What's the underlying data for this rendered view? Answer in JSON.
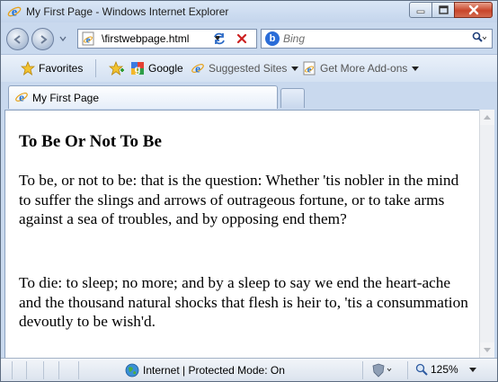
{
  "window": {
    "title": "My First Page - Windows Internet Explorer"
  },
  "address_bar": {
    "url": "\\firstwebpage.html"
  },
  "search": {
    "placeholder": "Bing"
  },
  "favorites_bar": {
    "favorites_label": "Favorites",
    "links": [
      {
        "label": "Google",
        "icon": "google-icon"
      },
      {
        "label": "Suggested Sites",
        "icon": "ie-page-icon"
      },
      {
        "label": "Get More Add-ons",
        "icon": "ie-page-icon"
      }
    ]
  },
  "tabs": [
    {
      "label": "My First Page",
      "active": true
    }
  ],
  "page": {
    "heading": "To Be Or Not To Be",
    "paragraphs": [
      "To be, or not to be: that is the question: Whether 'tis nobler in the mind to suffer the slings and arrows of outrageous fortune, or to take arms against a sea of troubles, and by opposing end them?",
      "To die: to sleep; no more; and by a sleep to say we end the heart-ache and the thousand natural shocks that flesh is heir to, 'tis a consummation devoutly to be wish'd."
    ]
  },
  "status_bar": {
    "zone": "Internet | Protected Mode: On",
    "zoom": "125%"
  },
  "colors": {
    "chrome": "#c9d9ee",
    "close_button": "#c8452a",
    "bing_blue": "#2b6dd8"
  }
}
